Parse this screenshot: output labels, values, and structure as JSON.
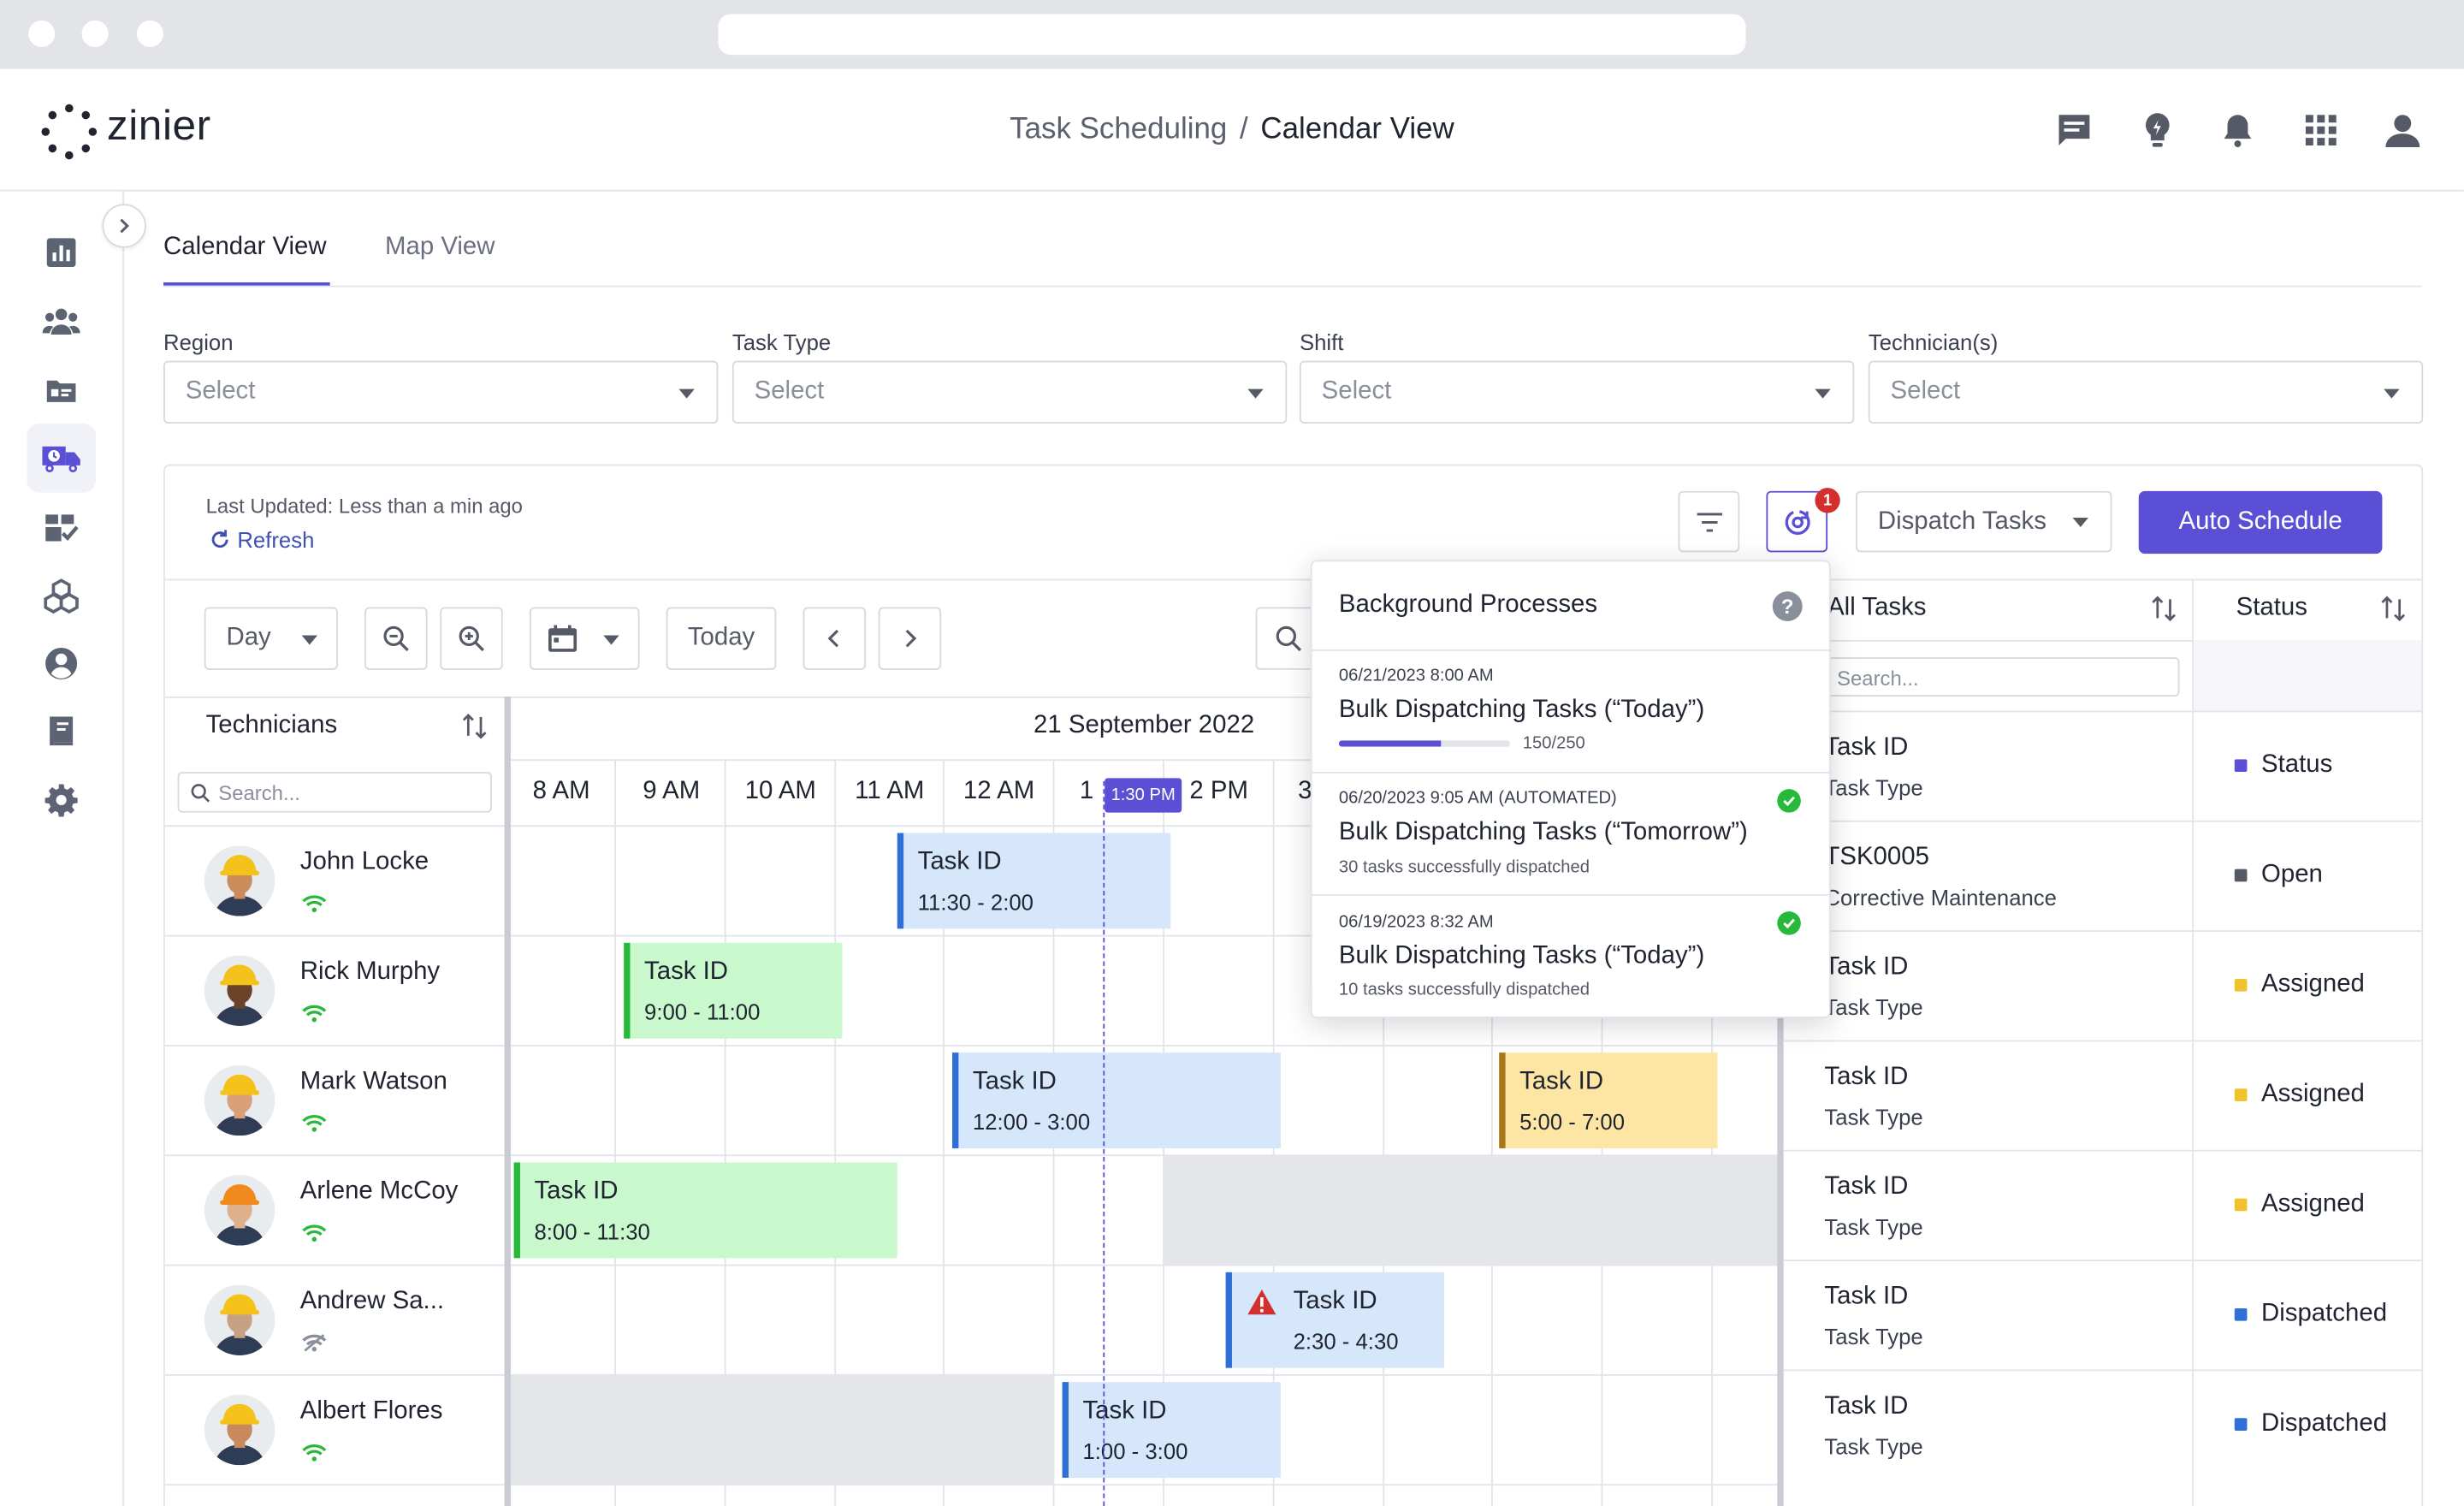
{
  "app": {
    "logo_text": "zinier",
    "breadcrumb": [
      "Task Scheduling",
      "Calendar View"
    ],
    "breadcrumb_sep": "/"
  },
  "header_icons": [
    "chat-icon",
    "lightbulb-icon",
    "bell-icon",
    "apps-grid-icon",
    "user-icon"
  ],
  "rail": {
    "items": [
      "analytics-icon",
      "team-icon",
      "id-card-icon",
      "dispatch-truck-icon",
      "inventory-check-icon",
      "boxes-icon",
      "profile-icon",
      "book-icon",
      "settings-icon"
    ],
    "active_index": 3
  },
  "tabs": [
    {
      "label": "Calendar View",
      "active": true
    },
    {
      "label": "Map View",
      "active": false
    }
  ],
  "filters": [
    {
      "label": "Region",
      "placeholder": "Select"
    },
    {
      "label": "Task Type",
      "placeholder": "Select"
    },
    {
      "label": "Shift",
      "placeholder": "Select"
    },
    {
      "label": "Technician(s)",
      "placeholder": "Select"
    }
  ],
  "status_bar": {
    "last_updated": "Last Updated: Less than a min ago",
    "refresh": "Refresh",
    "notifications_count": "1",
    "dispatch_select": "Dispatch Tasks",
    "auto_schedule": "Auto Schedule"
  },
  "toolbar": {
    "view_mode": "Day",
    "today": "Today"
  },
  "calendar": {
    "technicians_header": "Technicians",
    "search_placeholder": "Search...",
    "date": "21 September 2022",
    "hours": [
      "8 AM",
      "9 AM",
      "10 AM",
      "11 AM",
      "12 AM",
      "1",
      "2 PM",
      "3"
    ],
    "now_label": "1:30 PM",
    "technicians": [
      {
        "name": "John Locke",
        "online": true
      },
      {
        "name": "Rick Murphy",
        "online": true
      },
      {
        "name": "Mark Watson",
        "online": true
      },
      {
        "name": "Arlene McCoy",
        "online": true
      },
      {
        "name": "Andrew Sa...",
        "online": false
      },
      {
        "name": "Albert Flores",
        "online": true
      }
    ],
    "tasks": [
      {
        "row": 0,
        "label": "Task ID",
        "time": "11:30 - 2:00",
        "color": "blue"
      },
      {
        "row": 1,
        "label": "Task ID",
        "time": "9:00 - 11:00",
        "color": "green"
      },
      {
        "row": 2,
        "label": "Task ID",
        "time": "12:00 - 3:00",
        "color": "blue"
      },
      {
        "row": 2,
        "label": "Task ID",
        "time": "5:00 - 7:00",
        "color": "yellow"
      },
      {
        "row": 3,
        "label": "Task ID",
        "time": "8:00 - 11:30",
        "color": "green"
      },
      {
        "row": 4,
        "label": "Task ID",
        "time": "2:30 - 4:30",
        "color": "blue",
        "warning": true
      },
      {
        "row": 5,
        "label": "Task ID",
        "time": "1:00 - 3:00",
        "color": "blue"
      }
    ]
  },
  "task_list": {
    "header_all": "All Tasks",
    "header_status": "Status",
    "search_placeholder": "Search...",
    "rows": [
      {
        "id": "Task ID",
        "type": "Task Type",
        "status": "Status",
        "color": "#5b4fd6"
      },
      {
        "id": "TSK0005",
        "type": "Corrective Maintenance",
        "status": "Open",
        "color": "#555a66"
      },
      {
        "id": "Task ID",
        "type": "Task Type",
        "status": "Assigned",
        "color": "#f2c12e"
      },
      {
        "id": "Task ID",
        "type": "Task Type",
        "status": "Assigned",
        "color": "#f2c12e"
      },
      {
        "id": "Task ID",
        "type": "Task Type",
        "status": "Assigned",
        "color": "#f2c12e"
      },
      {
        "id": "Task ID",
        "type": "Task Type",
        "status": "Dispatched",
        "color": "#2f6fd6"
      },
      {
        "id": "Task ID",
        "type": "Task Type",
        "status": "Dispatched",
        "color": "#2f6fd6"
      }
    ]
  },
  "background_processes": {
    "title": "Background Processes",
    "items": [
      {
        "meta": "06/21/2023 8:00 AM",
        "name": "Bulk Dispatching Tasks (“Today”)",
        "note": "150/250",
        "progress": 0.6,
        "done": false
      },
      {
        "meta": "06/20/2023 9:05 AM (AUTOMATED)",
        "name": "Bulk Dispatching Tasks (“Tomorrow”)",
        "note": "30 tasks successfully dispatched",
        "done": true
      },
      {
        "meta": "06/19/2023 8:32 AM",
        "name": "Bulk Dispatching Tasks (“Today”)",
        "note": "10 tasks successfully dispatched",
        "done": true
      }
    ]
  },
  "colors": {
    "accent": "#5b4fd6",
    "task_blue": "#d6e6fb",
    "task_green": "#c8f8cc",
    "task_yellow": "#fde6a3",
    "online": "#27b93a",
    "warning": "#d32f2f"
  }
}
